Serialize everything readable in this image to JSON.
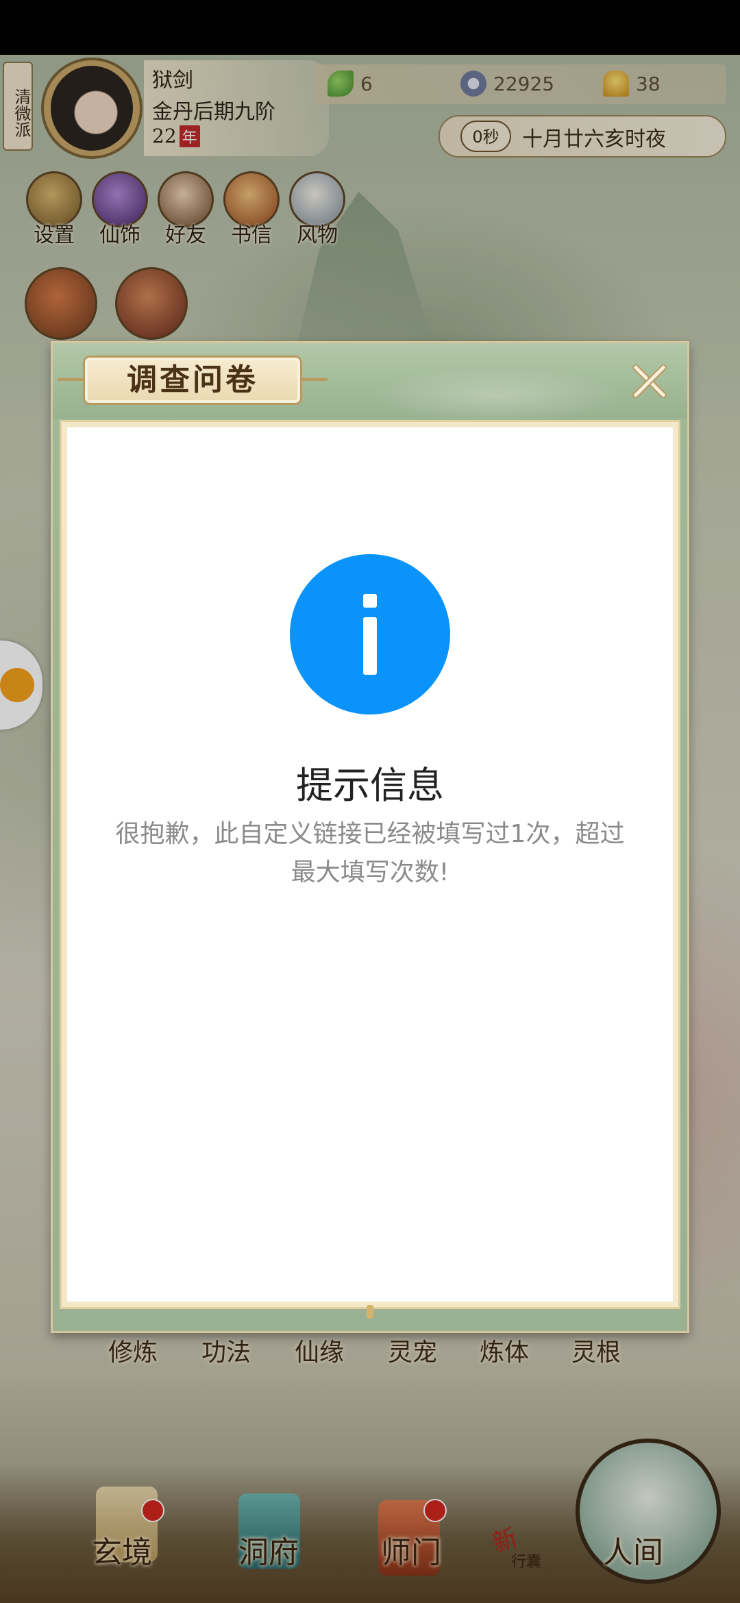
{
  "profile": {
    "sect": "清微派",
    "name": "狱剑",
    "rank": "金丹后期九阶",
    "age": "22",
    "age_unit": "年"
  },
  "resources": {
    "leaf": "6",
    "coins": "22925",
    "gold": "38"
  },
  "time": {
    "timer": "0秒",
    "text": "十月廿六亥时夜"
  },
  "top_icons": [
    {
      "label": "设置"
    },
    {
      "label": "仙饰"
    },
    {
      "label": "好友"
    },
    {
      "label": "书信"
    },
    {
      "label": "风物"
    }
  ],
  "skills": [
    "修炼",
    "功法",
    "仙缘",
    "灵宠",
    "炼体",
    "灵根"
  ],
  "nav": {
    "items": [
      "玄境",
      "洞府",
      "师门",
      "人间"
    ],
    "new_badge": "新",
    "new_sub": "行囊"
  },
  "modal": {
    "title": "调查问卷",
    "info_title": "提示信息",
    "info_message": "很抱歉，此自定义链接已经被填写过1次，超过最大填写次数!"
  },
  "colors": {
    "info_blue": "#0a94fb",
    "modal_green": "#9fb896",
    "message_gray": "#8a8a8a"
  }
}
